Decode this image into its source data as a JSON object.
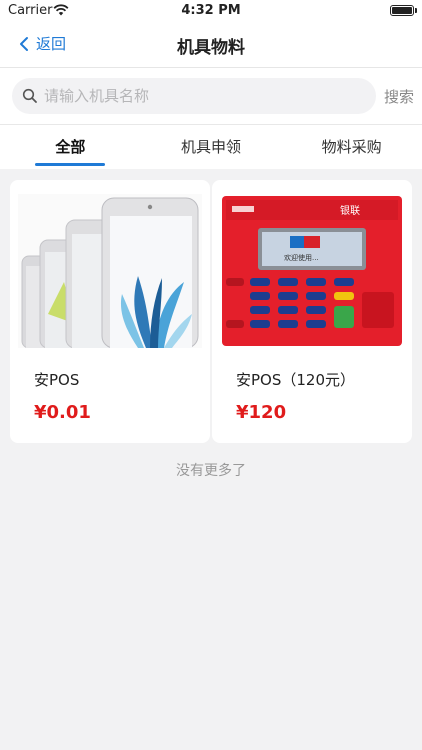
{
  "status": {
    "carrier": "Carrier",
    "time": "4:32 PM"
  },
  "nav": {
    "back_label": "返回",
    "title": "机具物料"
  },
  "search": {
    "placeholder": "请输入机具名称",
    "button": "搜索"
  },
  "tabs": [
    {
      "label": "全部",
      "active": true
    },
    {
      "label": "机具申领",
      "active": false
    },
    {
      "label": "物料采购",
      "active": false
    }
  ],
  "products": [
    {
      "name": "安POS",
      "price": "¥0.01",
      "image": "iphone-image"
    },
    {
      "name": "安POS（120元）",
      "price": "¥120",
      "image": "pos-terminal-image"
    }
  ],
  "pos_screen": {
    "brand": "UnionPay",
    "welcome": "欢迎使用..."
  },
  "footer": {
    "no_more": "没有更多了"
  },
  "colors": {
    "accent": "#1f7ad6",
    "price": "#e01b1b",
    "background": "#f2f2f3"
  }
}
